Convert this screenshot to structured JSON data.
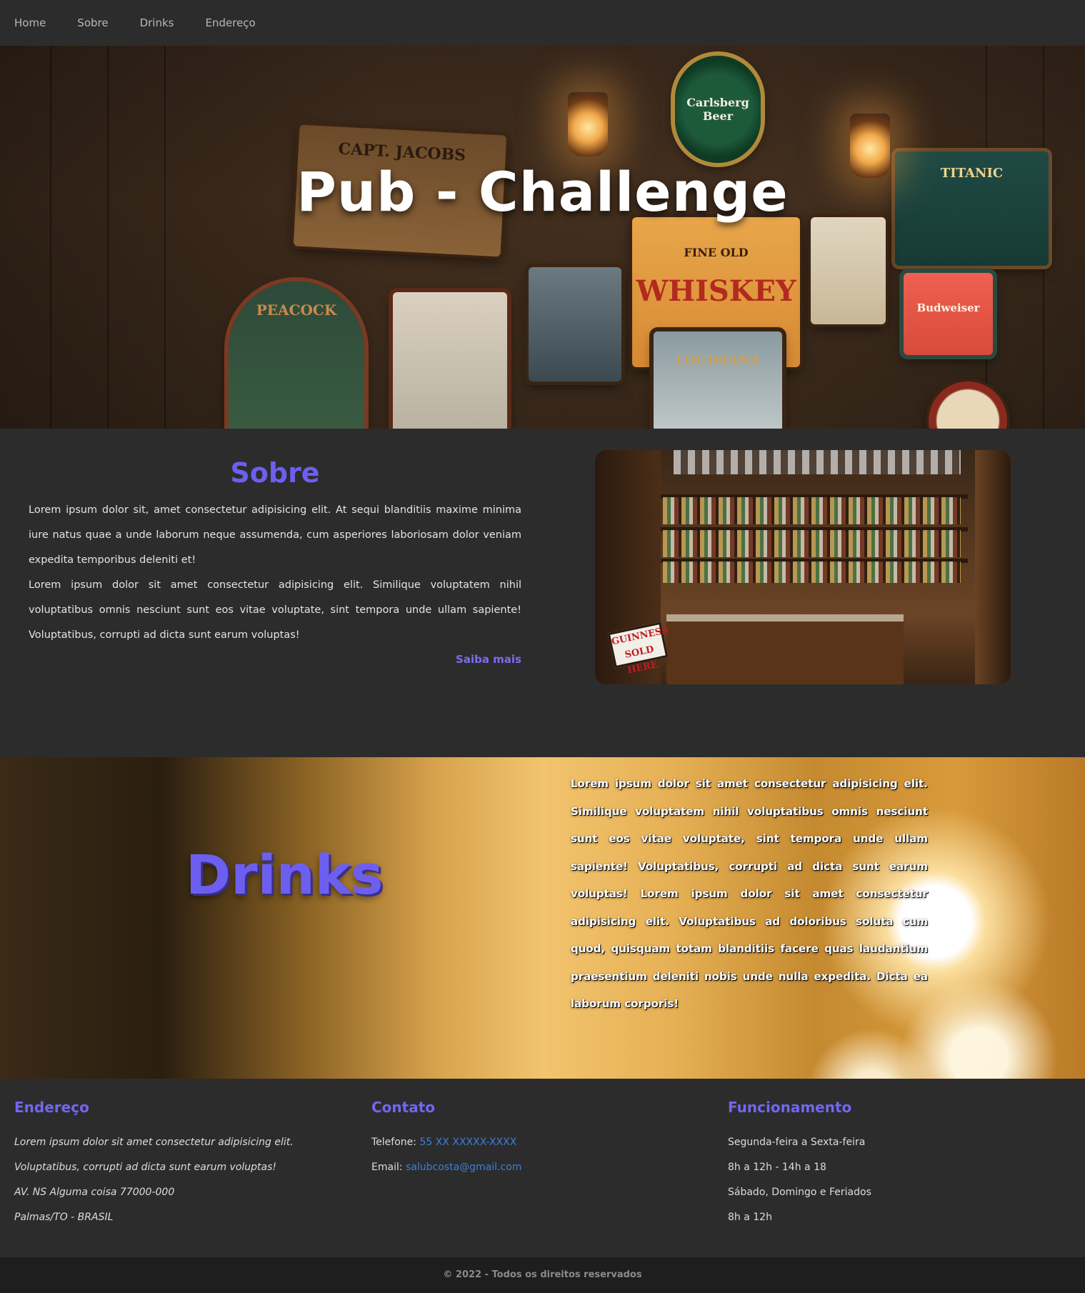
{
  "nav": {
    "items": [
      "Home",
      "Sobre",
      "Drinks",
      "Endereço"
    ]
  },
  "hero": {
    "title": "Pub - Challenge",
    "signs": {
      "capt_jacobs": "CAPT. JACOBS",
      "carlsberg": "Carlsberg Beer",
      "whiskey": "WHISKEY",
      "fine_old": "FINE OLD",
      "titanic": "TITANIC",
      "peacock": "PEACOCK",
      "budweiser": "Budweiser",
      "louisiana": "LOUISIANA"
    }
  },
  "sobre": {
    "title": "Sobre",
    "paragraph1": "Lorem ipsum dolor sit, amet consectetur adipisicing elit. At sequi blanditiis maxime minima iure natus quae a unde laborum neque assumenda, cum asperiores laboriosam dolor veniam expedita temporibus deleniti et!",
    "paragraph2": "Lorem ipsum dolor sit amet consectetur adipisicing elit. Similique voluptatem nihil voluptatibus omnis nesciunt sunt eos vitae voluptate, sint tempora unde ullam sapiente! Voluptatibus, corrupti ad dicta sunt earum voluptas!",
    "link": "Saiba mais",
    "photo_sign": "GUINNESS SOLD HERE"
  },
  "drinks": {
    "title": "Drinks",
    "text": "Lorem ipsum dolor sit amet consectetur adipisicing elit. Similique voluptatem nihil voluptatibus omnis nesciunt sunt eos vitae voluptate, sint tempora unde ullam sapiente! Voluptatibus, corrupti ad dicta sunt earum voluptas! Lorem ipsum dolor sit amet consectetur adipisicing elit. Voluptatibus ad doloribus soluta cum quod, quisquam totam blanditiis facere quas laudantium praesentium deleniti nobis unde nulla expedita. Dicta ea laborum corporis!"
  },
  "endereco": {
    "title": "Endereço",
    "lines": [
      "Lorem ipsum dolor sit amet consectetur adipisicing elit.",
      "Voluptatibus, corrupti ad dicta sunt earum voluptas!",
      "AV. NS Alguma coisa 77000-000",
      "Palmas/TO - BRASIL"
    ]
  },
  "contato": {
    "title": "Contato",
    "phone_label": "Telefone:",
    "phone": "55 XX XXXXX-XXXX",
    "email_label": "Email:",
    "email": "salubcosta@gmail.com"
  },
  "funcionamento": {
    "title": "Funcionamento",
    "lines": [
      "Segunda-feira a Sexta-feira",
      "8h a 12h - 14h a 18",
      "Sábado, Domingo e Feriados",
      "8h a 12h"
    ]
  },
  "footer": {
    "copyright": "© 2022 - Todos os direitos reservados"
  },
  "colors": {
    "background": "#2c2c2c",
    "accent": "#6c5ff0",
    "link": "#3d7fd6",
    "footer_bar": "#1e1e1e"
  }
}
